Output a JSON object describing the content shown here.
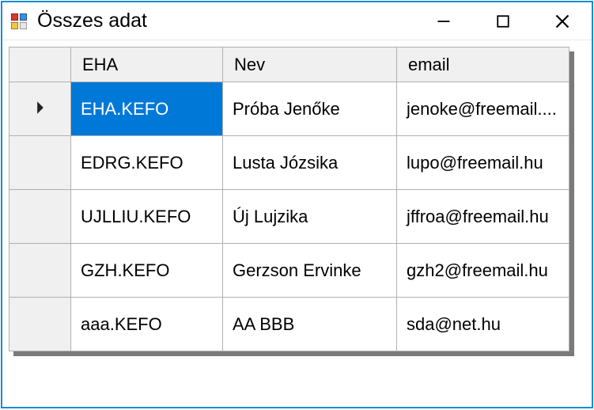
{
  "window": {
    "title": "Összes adat"
  },
  "grid": {
    "columns": {
      "eha": "EHA",
      "nev": "Nev",
      "email": "email"
    },
    "rows": [
      {
        "eha": "EHA.KEFO",
        "nev": "Próba Jenőke",
        "email": "jenoke@freemail...."
      },
      {
        "eha": "EDRG.KEFO",
        "nev": "Lusta Józsika",
        "email": "lupo@freemail.hu"
      },
      {
        "eha": "UJLLIU.KEFO",
        "nev": "Új Lujzika",
        "email": "jffroa@freemail.hu"
      },
      {
        "eha": "GZH.KEFO",
        "nev": "Gerzson Ervinke",
        "email": "gzh2@freemail.hu"
      },
      {
        "eha": "aaa.KEFO",
        "nev": "AA BBB",
        "email": "sda@net.hu"
      }
    ],
    "selected": {
      "row": 0,
      "col": "eha"
    }
  }
}
